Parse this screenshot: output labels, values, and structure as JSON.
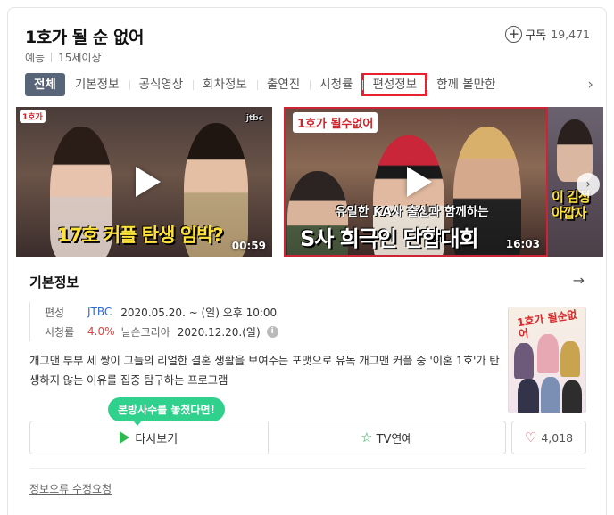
{
  "program": {
    "title": "1호가 될 순 없어",
    "genre": "예능",
    "rating": "15세이상"
  },
  "subscribe": {
    "plus": "+",
    "label": "구독",
    "count": "19,471"
  },
  "tabs": [
    {
      "label": "전체",
      "active": true
    },
    {
      "label": "기본정보"
    },
    {
      "label": "공식영상"
    },
    {
      "label": "회차정보"
    },
    {
      "label": "출연진"
    },
    {
      "label": "시청률"
    },
    {
      "label": "편성정보",
      "highlighted": true
    },
    {
      "label": "함께 볼만한"
    }
  ],
  "tabs_next_icon": "chevron-right-icon",
  "videos": [
    {
      "caption": "17호 커플 탄생 임박?",
      "duration": "00:59",
      "channel_badge": "jtbc"
    },
    {
      "caption_top": "유일한 KA사 출신과 함께하는",
      "caption": "S사 희극인 단합대회",
      "duration": "16:03",
      "logo": "1호가 될수없어"
    },
    {
      "caption": "이 김정 아깝자"
    }
  ],
  "info": {
    "heading": "기본정보",
    "broadcast_label": "편성",
    "channel": "JTBC",
    "schedule": "2020.05.20. ~  (일) 오후 10:00",
    "ratings_label": "시청률",
    "ratings_value": "4.0%",
    "ratings_source": "닐슨코리아",
    "ratings_date": "2020.12.20.(일)",
    "description": "개그맨 부부 세 쌍이 그들의 리얼한 결혼 생활을 보여주는 포맷으로 유독 개그맨 커플 중 '이혼 1호'가 탄생하지 않는 이유를 집중 탐구하는 프로그램",
    "poster_title": "1호가 될순없어"
  },
  "tooltip": "본방사수를 놓쳤다면!",
  "buttons": {
    "rewatch": "다시보기",
    "tv": "TV연예",
    "like_count": "4,018"
  },
  "report_link": "정보오류 수정요청",
  "colors": {
    "active_tab": "#586578",
    "highlight": "#e8212e",
    "link_blue": "#2d6ad4",
    "rating_red": "#e04141",
    "tooltip": "#2fd18c"
  }
}
